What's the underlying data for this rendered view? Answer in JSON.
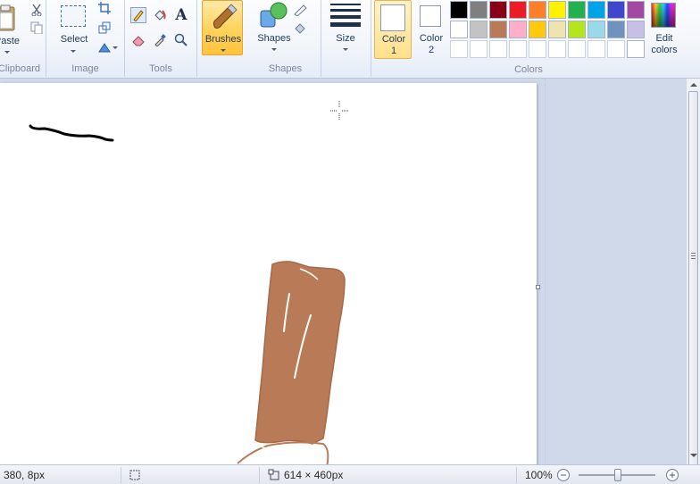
{
  "ribbon": {
    "clipboard": {
      "paste_label": "Paste",
      "group_label": "Clipboard"
    },
    "image": {
      "select_label": "Select",
      "group_label": "Image"
    },
    "tools": {
      "group_label": "Tools"
    },
    "brushes": {
      "label": "Brushes"
    },
    "shapes": {
      "label": "Shapes",
      "group_label": "Shapes"
    },
    "size": {
      "label": "Size"
    },
    "color1": {
      "label": "Color",
      "sub": "1"
    },
    "color2": {
      "label": "Color",
      "sub": "2"
    },
    "colors": {
      "group_label": "Colors",
      "edit_label": "Edit",
      "edit_sub": "colors",
      "palette": [
        "#000000",
        "#7f7f7f",
        "#880015",
        "#ed1c24",
        "#ff7f27",
        "#fff200",
        "#22b14c",
        "#00a2e8",
        "#3f48cc",
        "#ffffff",
        "#c3c3c3",
        "#b97a57",
        "#ffaec9",
        "#ffc90e",
        "#efe4b0",
        "#b5e61d",
        "#99d9ea",
        "#7092be",
        "#ffffff",
        "#ffffff",
        "#ffffff",
        "#ffffff",
        "#ffffff",
        "#ffffff",
        "#ffffff",
        "#ffffff",
        "#ffffff"
      ],
      "extra_col": [
        "#a349a4",
        "#c8bfe7",
        "#ffffff"
      ]
    }
  },
  "canvas": {
    "stroke_black": "#000000",
    "fill_brown": "#b97a57"
  },
  "status": {
    "cursor_pos": "380, 8px",
    "image_size": "614 × 460px",
    "zoom": "100%"
  }
}
